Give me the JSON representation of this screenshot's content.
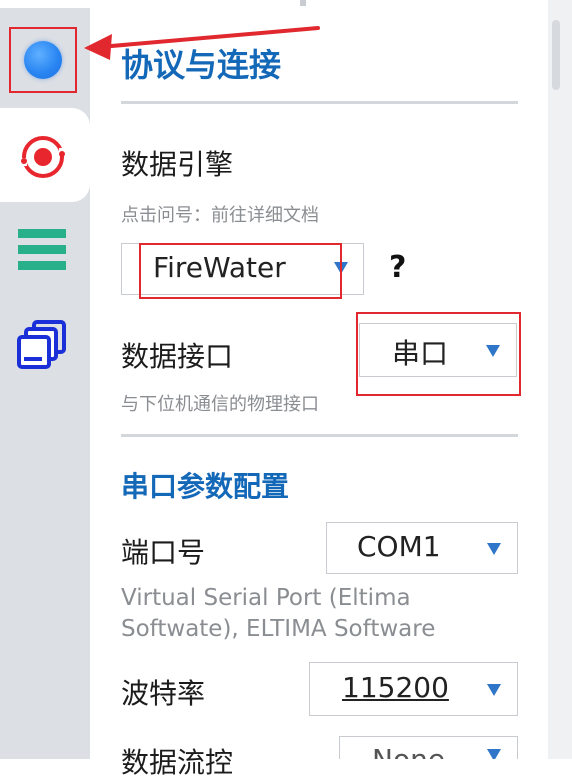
{
  "sidebar": {
    "icons": [
      "logo-circle",
      "target-icon",
      "menu-lines-icon",
      "copy-window-icon"
    ],
    "colors": {
      "logo": "#2a86f2",
      "target": "#e8262d",
      "menu": "#27b08a",
      "copy": "#1a2fd8"
    }
  },
  "header": {
    "title": "协议与连接"
  },
  "engine": {
    "label": "数据引擎",
    "hint": "点击问号：前往详细文档",
    "selected": "FireWater",
    "help": "?"
  },
  "interface": {
    "label": "数据接口",
    "selected": "串口",
    "hint": "与下位机通信的物理接口"
  },
  "serial_section": {
    "title": "串口参数配置"
  },
  "port": {
    "label": "端口号",
    "selected": "COM1",
    "hint_line1": "Virtual Serial Port (Eltima",
    "hint_line2": "Softwate), ELTIMA Software"
  },
  "baud": {
    "label": "波特率",
    "selected": "115200"
  },
  "flow": {
    "label": "数据流控",
    "selected": "None"
  },
  "colors": {
    "accent": "#1468b8",
    "highlight": "#e0282e",
    "dropdown_arrow": "#2f76c8"
  }
}
